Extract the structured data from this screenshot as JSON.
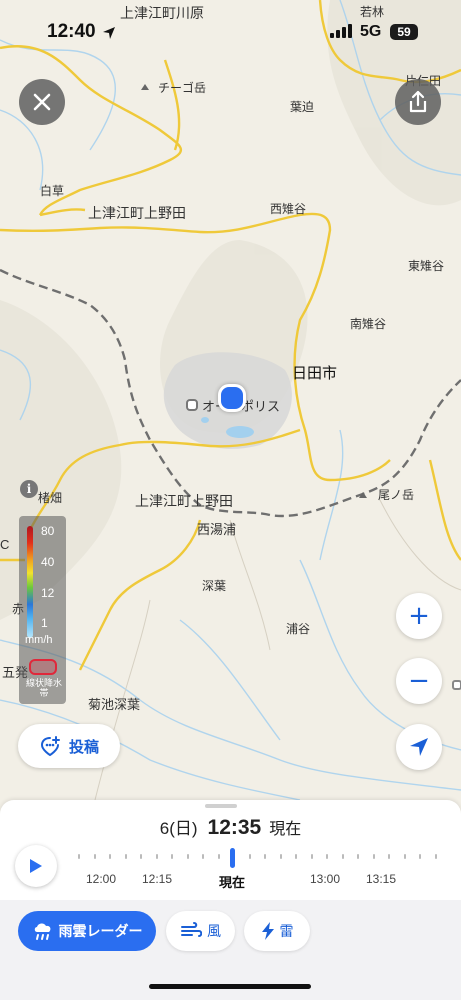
{
  "status_bar": {
    "time": "12:40",
    "network": "5G",
    "battery": "59"
  },
  "map": {
    "places": [
      {
        "id": "kamitsue-kawahara",
        "label": "上津江町川原"
      },
      {
        "id": "wakamura",
        "label": "若林"
      },
      {
        "id": "chigo-dake",
        "label": "チーゴ岳"
      },
      {
        "id": "katani",
        "label": "片仁田"
      },
      {
        "id": "hasako",
        "label": "葉迫"
      },
      {
        "id": "shirakusa",
        "label": "白草"
      },
      {
        "id": "kamitsue-kaminoda",
        "label": "上津江町上野田"
      },
      {
        "id": "nishi-masugai",
        "label": "西雉谷"
      },
      {
        "id": "higashi-masugai",
        "label": "東雉谷"
      },
      {
        "id": "minami-masugai",
        "label": "南雉谷"
      },
      {
        "id": "hita-city",
        "label": "日田市"
      },
      {
        "id": "autopolis",
        "label": "オートポリス"
      },
      {
        "id": "kamitsue-kaminoda-2",
        "label": "上津江町上野田"
      },
      {
        "id": "kobatake",
        "label": "楮畑"
      },
      {
        "id": "onodake",
        "label": "尾ノ岳"
      },
      {
        "id": "nishiyunoura",
        "label": "西湯浦"
      },
      {
        "id": "fukaba",
        "label": "深葉"
      },
      {
        "id": "uratani",
        "label": "浦谷"
      },
      {
        "id": "kikuchi-fukaba",
        "label": "菊池深葉"
      },
      {
        "id": "akasaka",
        "label": "赤"
      },
      {
        "id": "gohatsu",
        "label": "五発"
      },
      {
        "id": "c-edge",
        "label": "C"
      }
    ]
  },
  "legend": {
    "levels": [
      "80",
      "40",
      "12",
      "1"
    ],
    "unit": "mm/h",
    "note": "線状降水帯",
    "colors": [
      "#b0161f",
      "#f0a020",
      "#f2e32c",
      "#6dc83c",
      "#2a77d8",
      "#b8e7fb"
    ]
  },
  "buttons": {
    "close_icon": "close-icon",
    "share_icon": "share-icon",
    "zoom_in": "+",
    "zoom_out": "−",
    "locate_icon": "location-arrow-icon",
    "post_label": "投稿"
  },
  "timebar": {
    "date": "6(日)",
    "time": "12:35",
    "now_label": "現在",
    "labels": [
      "12:00",
      "12:15",
      "現在",
      "13:00",
      "13:15"
    ]
  },
  "tabs": [
    {
      "label": "雨雲レーダー",
      "icon": "cloud-rain-icon",
      "active": true
    },
    {
      "label": "風",
      "icon": "wind-icon",
      "active": false
    },
    {
      "label": "雷",
      "icon": "lightning-icon",
      "active": false
    }
  ],
  "colors": {
    "accent": "#2a6ef0",
    "map_bg": "#f2efe6",
    "road": "#efc93a"
  }
}
